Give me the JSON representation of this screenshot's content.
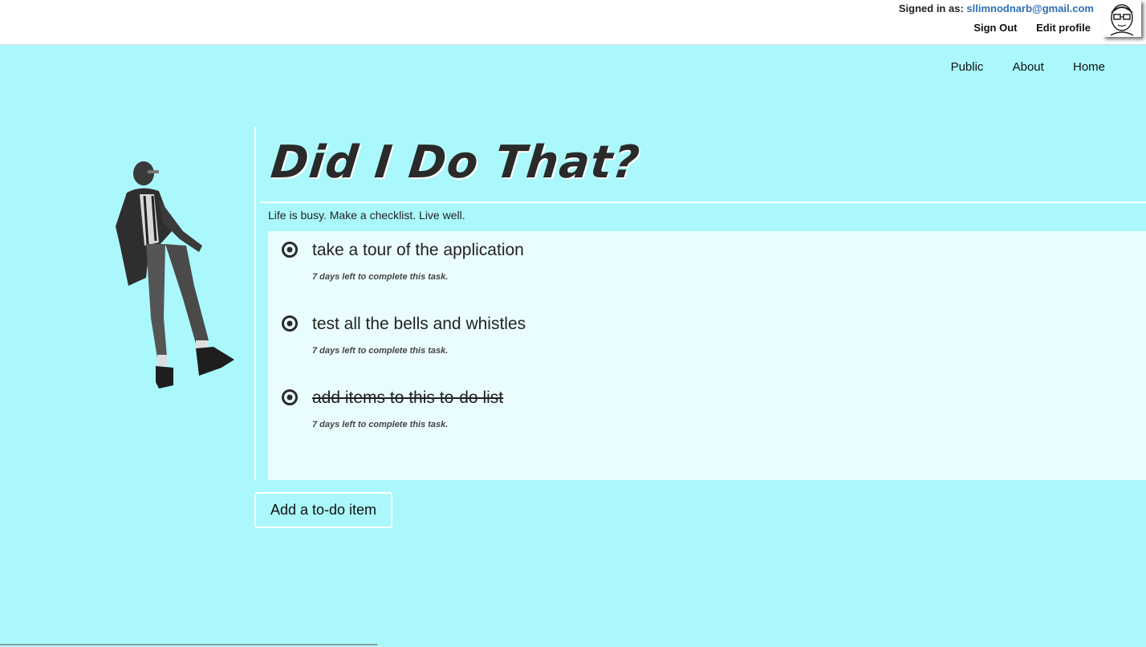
{
  "header": {
    "signed_in_label": "Signed in as:",
    "email": "sllimnodnarb@gmail.com",
    "sign_out": "Sign Out",
    "edit_profile": "Edit profile"
  },
  "nav": {
    "items": [
      "Public",
      "About",
      "Home"
    ]
  },
  "hero": {
    "title": "Did I Do That?",
    "tagline": "Life is busy. Make a checklist. Live well."
  },
  "todos": [
    {
      "title": "take a tour of the application",
      "meta": "7 days left to complete this task.",
      "done": false
    },
    {
      "title": "test all the bells and whistles",
      "meta": "7 days left to complete this task.",
      "done": false
    },
    {
      "title": "add items to this to-do list",
      "meta": "7 days left to complete this task.",
      "done": true
    }
  ],
  "actions": {
    "add_item": "Add a to-do item"
  },
  "colors": {
    "background": "#aaf8fb",
    "panel": "#eafdfe",
    "email_link": "#2e6fb8"
  }
}
